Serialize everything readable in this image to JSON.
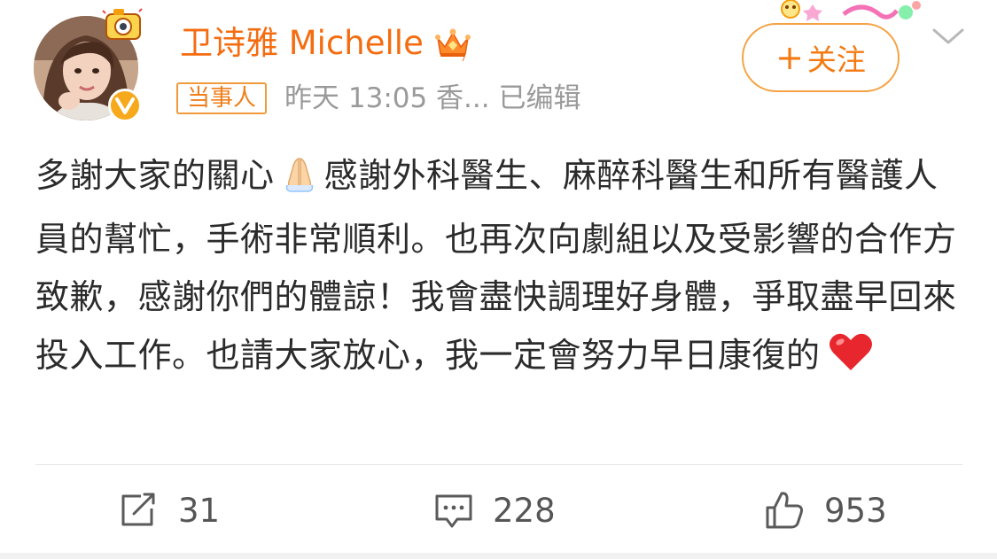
{
  "post": {
    "author": {
      "name": "卫诗雅 Michelle",
      "tag": "当事人",
      "avatar_icon": "avatar-photo",
      "badge_icon": "verified-v-icon",
      "vip_icon": "crown-icon"
    },
    "meta": "昨天 13:05  香...  已编辑",
    "follow_button": {
      "plus": "+",
      "label": "关注"
    },
    "content": {
      "line1_a": "多謝大家的關心",
      "line1_b": "感謝外科醫生、麻醉科醫生和所有醫護人員的幫忙，手術非常順利。也再次向劇組以及受影響的合作方致歉，感謝你們的體諒！我會盡快調理好身體，爭取盡早回來投入工作。也請大家放心，我一定會努力早日康復的",
      "emoji1": "folded-hands-emoji",
      "emoji2": "red-heart-emoji"
    },
    "actions": {
      "repost_count": "31",
      "comment_count": "228",
      "like_count": "953"
    }
  },
  "colors": {
    "accent": "#f56c10",
    "follow_border": "#f5a244",
    "verified": "#f7a91d",
    "meta_gray": "#9a9a9a",
    "text": "#2b2b2b"
  }
}
